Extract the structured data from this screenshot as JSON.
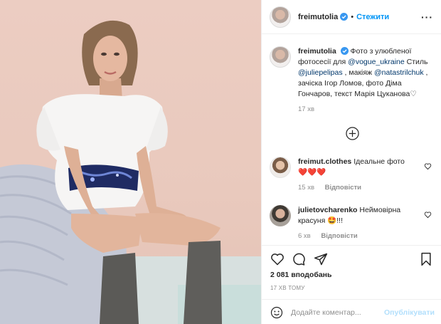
{
  "post": {
    "username": "freimutolia",
    "follow_label": "Стежити",
    "dot": "•",
    "more_icon": "more-horizontal-icon",
    "caption_text": "Фото з улюбленої фотосесії для",
    "caption_mention_vogue": "@vogue_ukraine",
    "caption_style": "Стиль",
    "caption_mention_julie": "@juliepelipas",
    "caption_makeup": ", макіяж",
    "caption_mention_nata": "@natastrilchuk",
    "caption_rest": ", зачіска Ігор Ломов, фото Діма Гончаров, текст Марія Цуканова♡",
    "caption_time": "17 хв",
    "likes": "2 081 вподобань",
    "timestamp": "17 ХВ ТОМУ"
  },
  "comments": [
    {
      "username": "freimut.clothes",
      "text": "Ідеальне фото",
      "emoji": "❤️❤️❤️",
      "time": "15 хв",
      "reply_label": "Відповісти"
    },
    {
      "username": "julietovcharenko",
      "text": "Неймовірна красуня",
      "emoji": "🤩!!!",
      "time": "6 хв",
      "reply_label": "Відповісти"
    }
  ],
  "add_comment": {
    "placeholder": "Додайте коментар...",
    "publish_label": "Опублікувати"
  },
  "colors": {
    "accent": "#0095f6",
    "link": "#00376b",
    "muted": "#8e8e8e",
    "verified": "#3897f0"
  }
}
